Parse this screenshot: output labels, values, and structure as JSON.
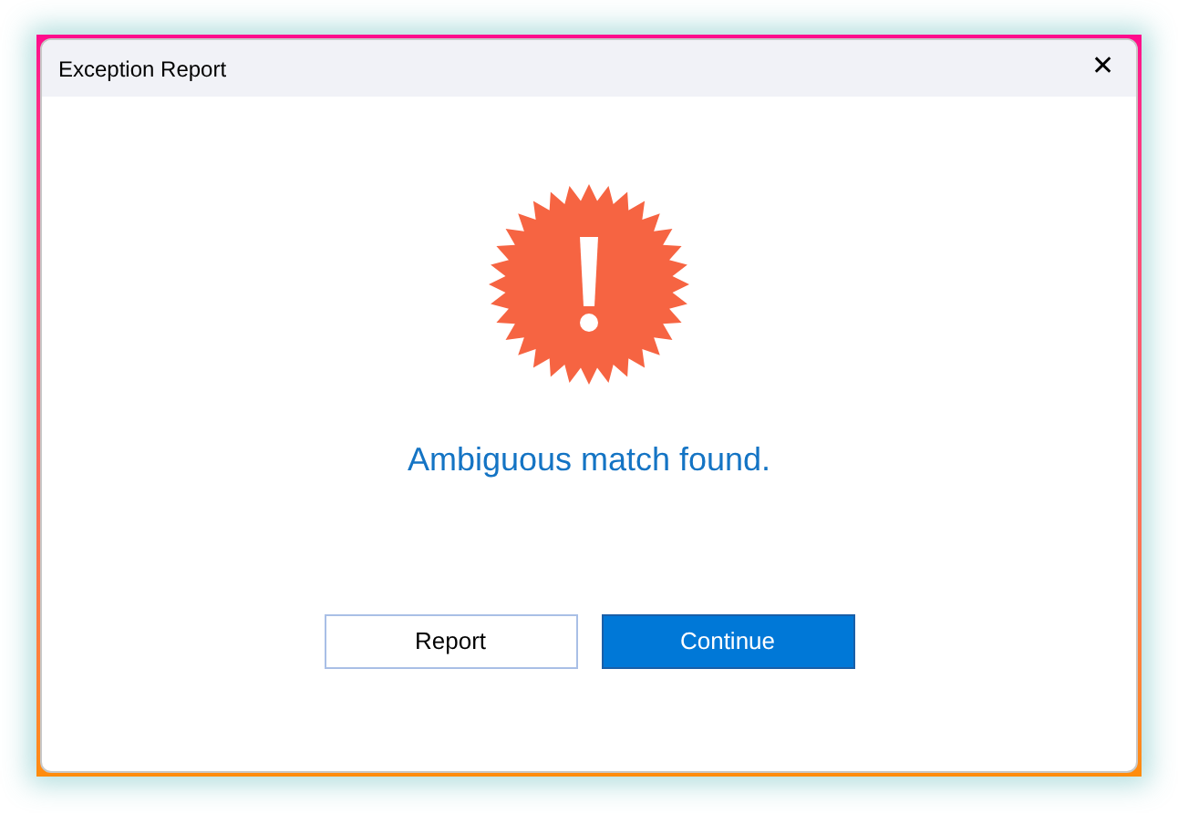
{
  "window": {
    "title": "Exception Report",
    "close": "✕"
  },
  "message": "Ambiguous match found.",
  "buttons": [
    {
      "label": "Report",
      "kind": "secondary"
    },
    {
      "label": "Continue",
      "kind": "primary"
    }
  ]
}
